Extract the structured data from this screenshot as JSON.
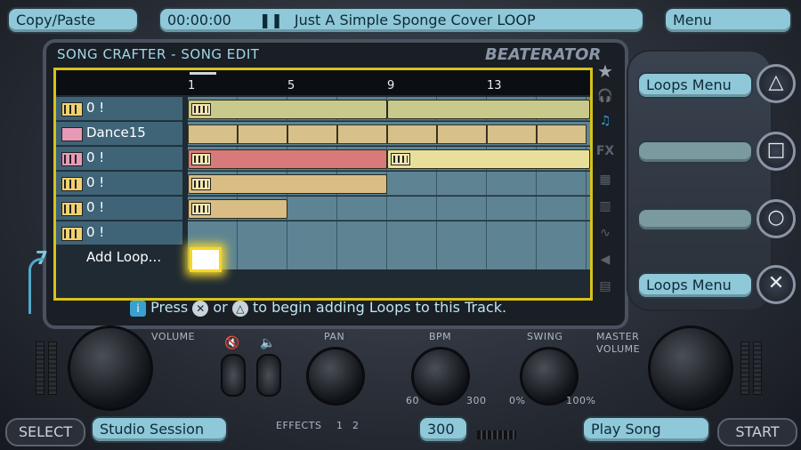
{
  "topbar": {
    "copy_paste": "Copy/Paste",
    "time": "00:00:00",
    "song_title": "Just A Simple Sponge Cover LOOP",
    "menu": "Menu"
  },
  "panel": {
    "title": "SONG CRAFTER - SONG EDIT",
    "brand": "BEATERATOR"
  },
  "ruler": [
    "1",
    "5",
    "9",
    "13"
  ],
  "tracks": [
    {
      "icon": "keyboard-icon",
      "label": "0 !"
    },
    {
      "icon": "drum-icon",
      "label": "Dance15"
    },
    {
      "icon": "keyboard-icon",
      "label": "0 !"
    },
    {
      "icon": "keyboard-icon",
      "label": "0 !"
    },
    {
      "icon": "keyboard-icon",
      "label": "0 !"
    },
    {
      "icon": "keyboard-icon",
      "label": "0 !"
    }
  ],
  "add_loop": "Add Loop...",
  "track_number": "7",
  "help": {
    "press": "Press",
    "or": "or",
    "rest": "to begin adding Loops to this Track."
  },
  "side": {
    "loops_menu_top": "Loops Menu",
    "loops_menu_bottom": "Loops Menu"
  },
  "controls": {
    "volume": "VOLUME",
    "pan": "PAN",
    "bpm_label": "BPM",
    "swing": "SWING",
    "master_volume_1": "MASTER",
    "master_volume_2": "VOLUME",
    "effects": "EFFECTS",
    "fx1": "1",
    "fx2": "2",
    "bpm_min": "60",
    "bpm_max": "300",
    "swing_min": "0%",
    "swing_max": "100%"
  },
  "bottombar": {
    "select": "SELECT",
    "session": "Studio Session",
    "bpm_value": "300",
    "play_song": "Play Song",
    "start": "START"
  },
  "colors": {
    "accent": "#8fc8d8",
    "grid_border": "#d9c21a"
  }
}
